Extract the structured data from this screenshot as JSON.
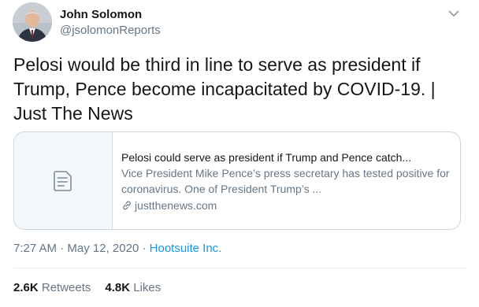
{
  "author": {
    "name": "John Solomon",
    "handle": "@jsolomonReports"
  },
  "tweet": {
    "text": "Pelosi would be third in line to serve as president if Trump, Pence become incapacitated by COVID-19. | Just The News"
  },
  "card": {
    "title": "Pelosi could serve as president if Trump and Pence catch...",
    "description": "Vice President Mike Pence’s press secretary has tested positive for coronavirus.  One of President Trump’s ...",
    "domain": "justthenews.com",
    "thumb_icon": "document-icon"
  },
  "meta": {
    "time": "7:27 AM",
    "separator1": " · ",
    "date": "May 12, 2020",
    "separator2": " · ",
    "source": "Hootsuite Inc."
  },
  "stats": {
    "retweets_count": "2.6K",
    "retweets_label": "Retweets",
    "likes_count": "4.8K",
    "likes_label": "Likes"
  },
  "colors": {
    "link": "#1b95e0",
    "secondary_text": "#657786",
    "border": "#ccd6dd"
  }
}
